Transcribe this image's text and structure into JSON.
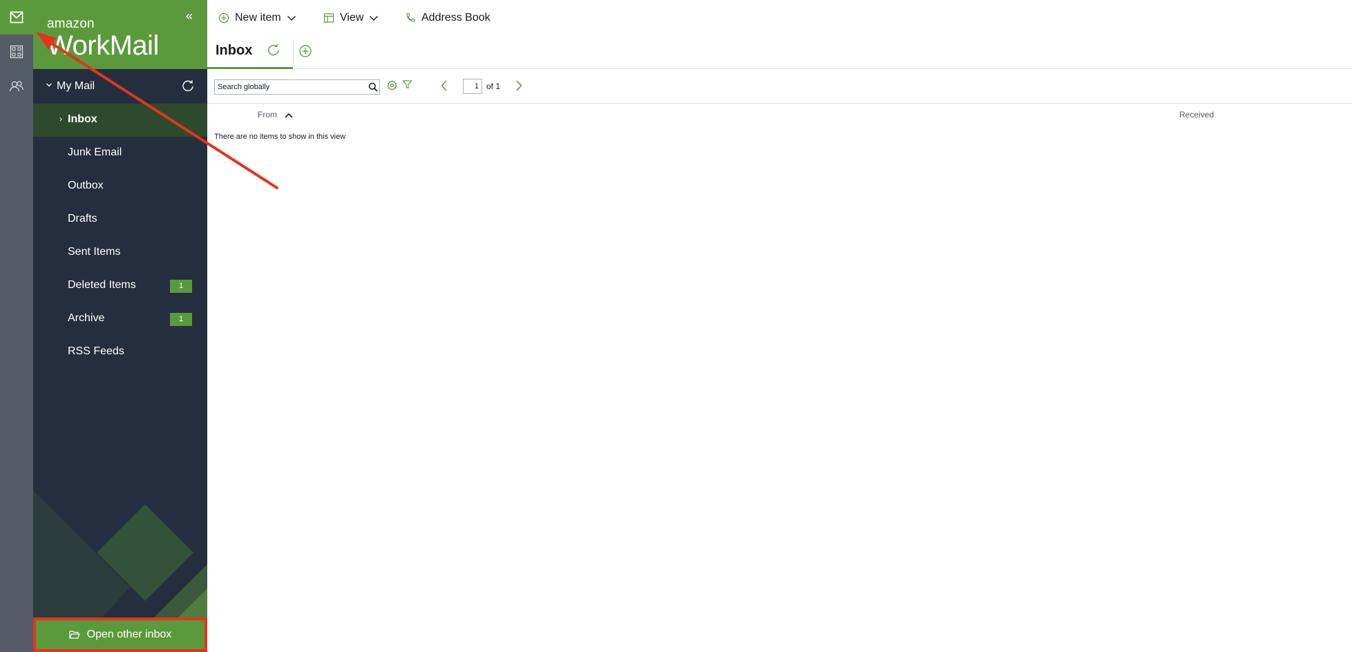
{
  "brand": {
    "line1": "amazon",
    "line2": "WorkMail",
    "accent_color": "#5a9a3c",
    "sidebar_color": "#232f3e",
    "rail_color": "#545b64"
  },
  "rail": {
    "items": [
      {
        "icon": "mail-icon",
        "active": true
      },
      {
        "icon": "calendar-icon",
        "active": false
      },
      {
        "icon": "contacts-icon",
        "active": false
      }
    ]
  },
  "sidebar": {
    "collapse_glyph": "«",
    "section_label": "My Mail",
    "folders": [
      {
        "label": "Inbox",
        "active": true,
        "badge": ""
      },
      {
        "label": "Junk Email",
        "active": false,
        "badge": ""
      },
      {
        "label": "Outbox",
        "active": false,
        "badge": ""
      },
      {
        "label": "Drafts",
        "active": false,
        "badge": ""
      },
      {
        "label": "Sent Items",
        "active": false,
        "badge": ""
      },
      {
        "label": "Deleted Items",
        "active": false,
        "badge": "1"
      },
      {
        "label": "Archive",
        "active": false,
        "badge": "1"
      },
      {
        "label": "RSS Feeds",
        "active": false,
        "badge": ""
      }
    ],
    "open_other_inbox": "Open other inbox"
  },
  "toolbar": {
    "new_item": "New item",
    "view": "View",
    "address_book": "Address Book"
  },
  "tabs": {
    "inbox": "Inbox"
  },
  "search": {
    "placeholder": "Search globally",
    "page_current": "1",
    "page_of": "of 1"
  },
  "list": {
    "col_from": "From",
    "col_received": "Received",
    "empty_message": "There are no items to show in this view"
  },
  "annotation": {
    "color": "#e8321e"
  }
}
